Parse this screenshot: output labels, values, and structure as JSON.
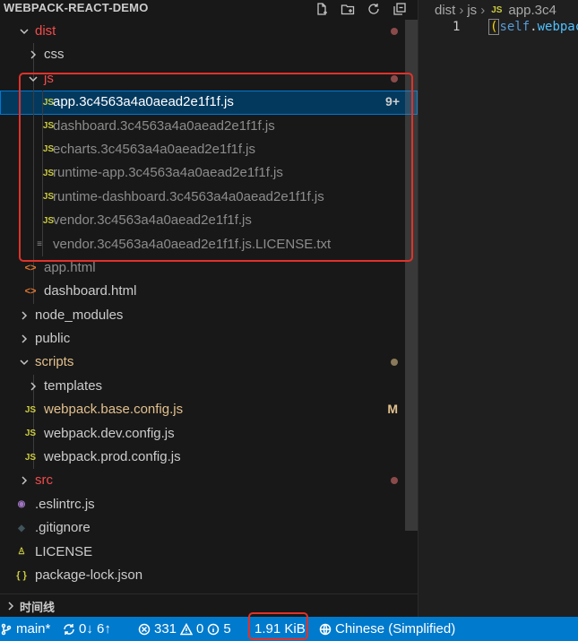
{
  "explorer": {
    "title": "WEBPACK-REACT-DEMO",
    "actions": [
      "new-file-icon",
      "new-folder-icon",
      "refresh-icon",
      "collapse-all-icon"
    ]
  },
  "tree": [
    {
      "label": "dist",
      "type": "folder",
      "open": true,
      "depth": 1,
      "color": "red",
      "dot": true
    },
    {
      "label": "css",
      "type": "folder",
      "open": false,
      "depth": 2
    },
    {
      "label": "js",
      "type": "folder",
      "open": true,
      "depth": 2,
      "color": "red",
      "dot": true
    },
    {
      "label": "app.3c4563a4a0aead2e1f1f.js",
      "type": "js",
      "depth": 3,
      "selected": true,
      "badge": "9+"
    },
    {
      "label": "dashboard.3c4563a4a0aead2e1f1f.js",
      "type": "js",
      "depth": 3,
      "dim": true
    },
    {
      "label": "echarts.3c4563a4a0aead2e1f1f.js",
      "type": "js",
      "depth": 3,
      "dim": true
    },
    {
      "label": "runtime-app.3c4563a4a0aead2e1f1f.js",
      "type": "js",
      "depth": 3,
      "dim": true
    },
    {
      "label": "runtime-dashboard.3c4563a4a0aead2e1f1f.js",
      "type": "js",
      "depth": 3,
      "dim": true
    },
    {
      "label": "vendor.3c4563a4a0aead2e1f1f.js",
      "type": "js",
      "depth": 3,
      "dim": true
    },
    {
      "label": "vendor.3c4563a4a0aead2e1f1f.js.LICENSE.txt",
      "type": "txt",
      "depth": 3,
      "dim": true
    },
    {
      "label": "app.html",
      "type": "html",
      "depth": 2,
      "dim": true
    },
    {
      "label": "dashboard.html",
      "type": "html",
      "depth": 2
    },
    {
      "label": "node_modules",
      "type": "folder",
      "open": false,
      "depth": 1
    },
    {
      "label": "public",
      "type": "folder",
      "open": false,
      "depth": 1
    },
    {
      "label": "scripts",
      "type": "folder",
      "open": true,
      "depth": 1,
      "color": "mod",
      "dot": true,
      "dotColor": "#8a7a5a"
    },
    {
      "label": "templates",
      "type": "folder",
      "open": false,
      "depth": 2
    },
    {
      "label": "webpack.base.config.js",
      "type": "js",
      "depth": 2,
      "color": "mod",
      "badge": "M"
    },
    {
      "label": "webpack.dev.config.js",
      "type": "js",
      "depth": 2
    },
    {
      "label": "webpack.prod.config.js",
      "type": "js",
      "depth": 2
    },
    {
      "label": "src",
      "type": "folder",
      "open": false,
      "depth": 1,
      "color": "red",
      "dot": true
    },
    {
      "label": ".eslintrc.js",
      "type": "eslint",
      "depth": 1
    },
    {
      "label": ".gitignore",
      "type": "git",
      "depth": 1
    },
    {
      "label": "LICENSE",
      "type": "license",
      "depth": 1
    },
    {
      "label": "package-lock.json",
      "type": "json",
      "depth": 1
    }
  ],
  "timeline": {
    "label": "时间线"
  },
  "editor": {
    "breadcrumb": [
      "dist",
      "js",
      "app.3c4"
    ],
    "line_number": "1",
    "code_open": "(",
    "code_kw": "self",
    "code_dot": ".",
    "code_prop": "webpac"
  },
  "statusbar": {
    "branch": "main*",
    "sync": "0↓ 6↑",
    "errors": "331",
    "warnings": "0",
    "info": "5",
    "size": "1.91 KiB",
    "language": "Chinese (Simplified)"
  },
  "colors": {
    "accent": "#007acc",
    "selection": "#04395e",
    "highlight": "#e0322a",
    "modified": "#e2c08d",
    "error": "#f14c4c"
  }
}
